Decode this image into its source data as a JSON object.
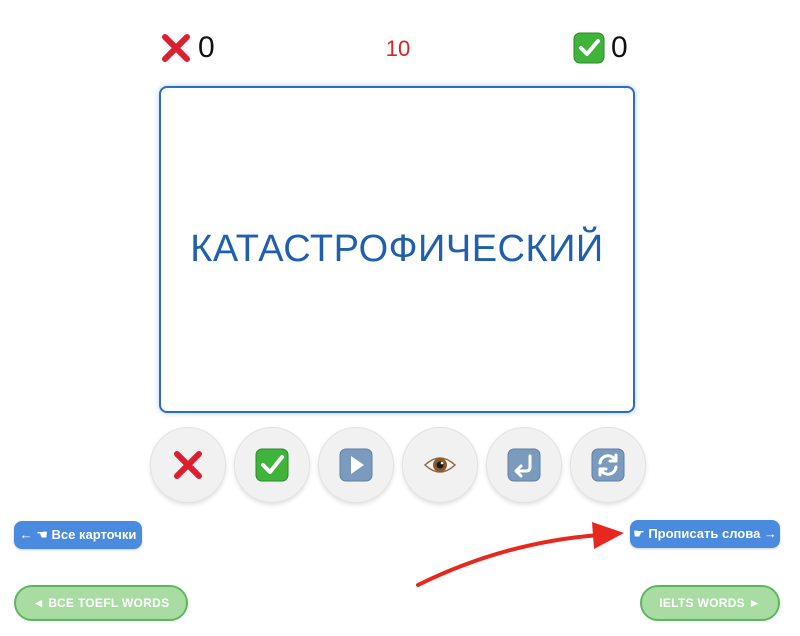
{
  "scores": {
    "wrong_icon": "red-cross-icon",
    "wrong_count": "0",
    "right_icon": "green-check-icon",
    "right_count": "0"
  },
  "timer": {
    "value": "10",
    "color": "#e02020"
  },
  "card": {
    "word": "КАТАСТРОФИЧЕСКИЙ",
    "border_color": "#2b6cc4"
  },
  "controls": [
    {
      "icon": "red-cross-icon"
    },
    {
      "icon": "green-check-icon"
    },
    {
      "icon": "play-icon"
    },
    {
      "icon": "eye-icon"
    },
    {
      "icon": "return-icon"
    },
    {
      "icon": "refresh-icon"
    }
  ],
  "nav": {
    "all_cards_label": "← ☚ Все карточки",
    "write_words_label": "☛ Прописать слова →",
    "toefl_label": "◄  ВСЕ TOEFL WORDS",
    "ielts_label": "IELTS WORDS  ►"
  },
  "colors": {
    "accent_blue": "#4a8be0",
    "green_button": "#a9dca3",
    "annotation_arrow": "#e8281e"
  }
}
